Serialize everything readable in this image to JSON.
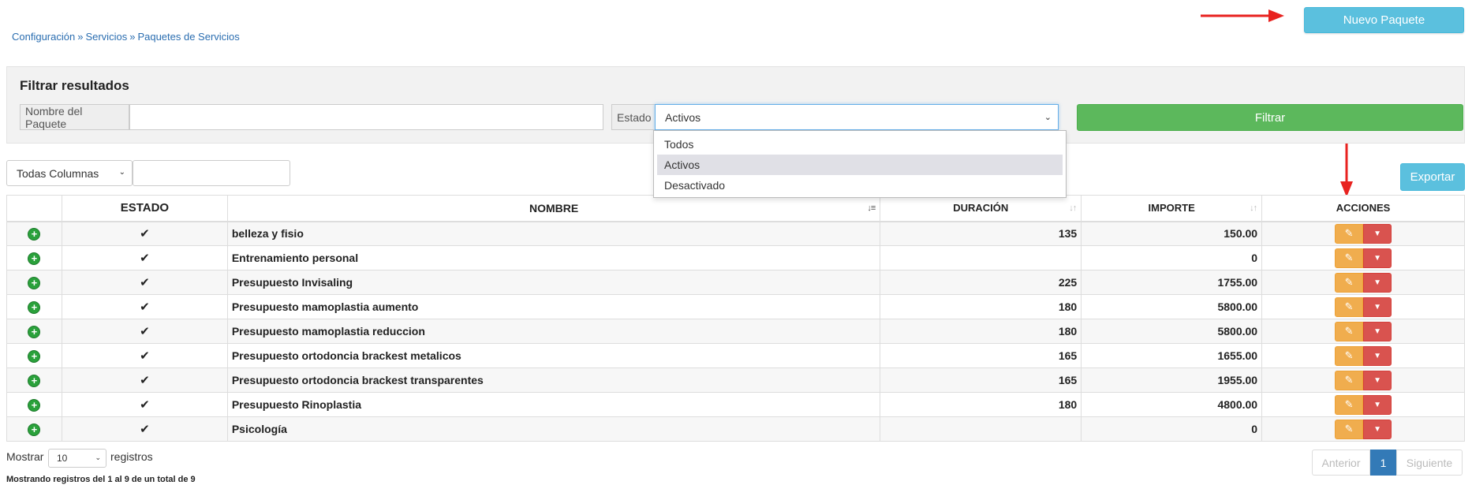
{
  "breadcrumb": {
    "items": [
      "Configuración",
      "Servicios",
      "Paquetes de Servicios"
    ],
    "separator": "»"
  },
  "header": {
    "new_button": "Nuevo Paquete"
  },
  "filter": {
    "title": "Filtrar resultados",
    "name_label": "Nombre del Paquete",
    "name_value": "",
    "estado_label": "Estado",
    "estado_value": "Activos",
    "estado_options": [
      "Todos",
      "Activos",
      "Desactivado"
    ],
    "filter_button": "Filtrar"
  },
  "toolbar": {
    "columns_select": "Todas Columnas",
    "search_value": "",
    "export_button": "Exportar"
  },
  "table": {
    "headers": {
      "estado": "ESTADO",
      "nombre": "NOMBRE",
      "duracion": "DURACIÓN",
      "importe": "IMPORTE",
      "acciones": "ACCIONES"
    },
    "rows": [
      {
        "estado": "✔",
        "nombre": "belleza y fisio",
        "duracion": "135",
        "importe": "150.00"
      },
      {
        "estado": "✔",
        "nombre": "Entrenamiento personal",
        "duracion": "",
        "importe": "0"
      },
      {
        "estado": "✔",
        "nombre": "Presupuesto Invisaling",
        "duracion": "225",
        "importe": "1755.00"
      },
      {
        "estado": "✔",
        "nombre": "Presupuesto mamoplastia aumento",
        "duracion": "180",
        "importe": "5800.00"
      },
      {
        "estado": "✔",
        "nombre": "Presupuesto mamoplastia reduccion",
        "duracion": "180",
        "importe": "5800.00"
      },
      {
        "estado": "✔",
        "nombre": "Presupuesto ortodoncia brackest metalicos",
        "duracion": "165",
        "importe": "1655.00"
      },
      {
        "estado": "✔",
        "nombre": "Presupuesto ortodoncia brackest transparentes",
        "duracion": "165",
        "importe": "1955.00"
      },
      {
        "estado": "✔",
        "nombre": "Presupuesto Rinoplastia",
        "duracion": "180",
        "importe": "4800.00"
      },
      {
        "estado": "✔",
        "nombre": "Psicología",
        "duracion": "",
        "importe": "0"
      }
    ]
  },
  "footer": {
    "show_label": "Mostrar",
    "page_length": "10",
    "records_label": "registros",
    "info": "Mostrando registros del 1 al 9 de un total de 9",
    "prev": "Anterior",
    "current_page": "1",
    "next": "Siguiente"
  },
  "colors": {
    "info_button": "#5bc0de",
    "success_button": "#5cb85c",
    "edit_button": "#f0ad4e",
    "danger_button": "#d9534f",
    "link": "#337ab7",
    "annotation_arrow": "#e8221f"
  },
  "icons": {
    "expand": "plus-circle-icon",
    "estado": "check-icon",
    "edit": "pencil-icon",
    "dropdown": "chevron-down-icon"
  }
}
